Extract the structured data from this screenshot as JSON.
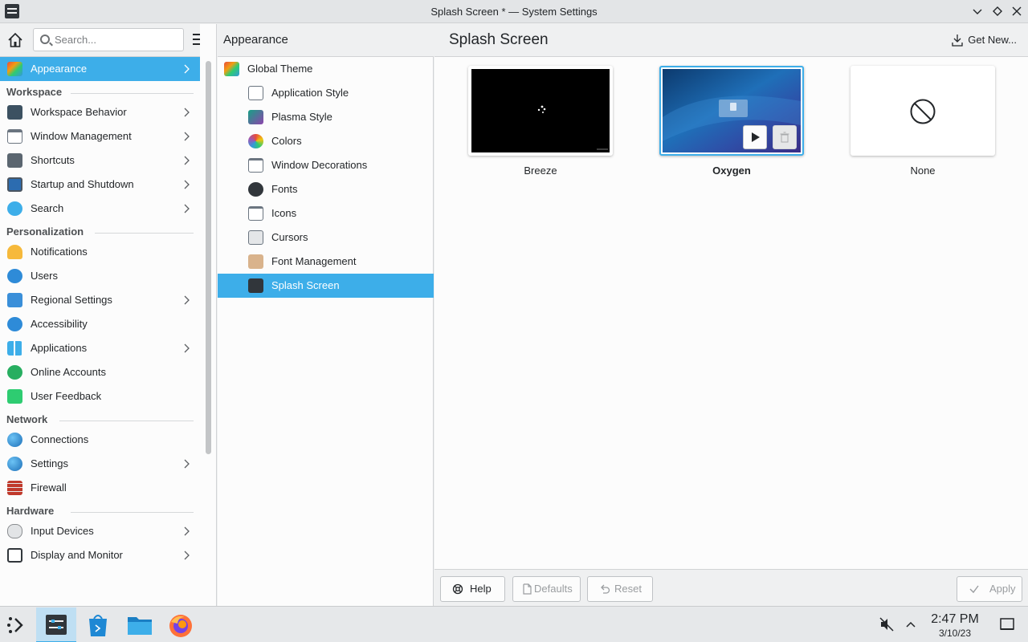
{
  "window": {
    "title": "Splash Screen * — System Settings",
    "controls": {
      "minimize": "⌄",
      "maximize": "◇",
      "close": "✕"
    }
  },
  "sidebar": {
    "search_placeholder": "Search...",
    "items": [
      {
        "label": "Appearance",
        "icon": "appearance-icon",
        "chevron": true,
        "active": true
      },
      {
        "category": "Workspace"
      },
      {
        "label": "Workspace Behavior",
        "icon": "workspace-behavior-icon",
        "chevron": true
      },
      {
        "label": "Window Management",
        "icon": "window-management-icon",
        "chevron": true
      },
      {
        "label": "Shortcuts",
        "icon": "keyboard-icon",
        "chevron": true
      },
      {
        "label": "Startup and Shutdown",
        "icon": "startup-icon",
        "chevron": true
      },
      {
        "label": "Search",
        "icon": "search-icon",
        "chevron": true
      },
      {
        "category": "Personalization"
      },
      {
        "label": "Notifications",
        "icon": "bell-icon"
      },
      {
        "label": "Users",
        "icon": "users-icon"
      },
      {
        "label": "Regional Settings",
        "icon": "regional-icon",
        "chevron": true
      },
      {
        "label": "Accessibility",
        "icon": "accessibility-icon"
      },
      {
        "label": "Applications",
        "icon": "applications-icon",
        "chevron": true
      },
      {
        "label": "Online Accounts",
        "icon": "online-accounts-icon"
      },
      {
        "label": "User Feedback",
        "icon": "feedback-icon"
      },
      {
        "category": "Network"
      },
      {
        "label": "Connections",
        "icon": "globe-icon"
      },
      {
        "label": "Settings",
        "icon": "network-settings-icon",
        "chevron": true
      },
      {
        "label": "Firewall",
        "icon": "firewall-icon"
      },
      {
        "category": "Hardware"
      },
      {
        "label": "Input Devices",
        "icon": "mouse-icon",
        "chevron": true
      },
      {
        "label": "Display and Monitor",
        "icon": "monitor-icon",
        "chevron": true
      }
    ]
  },
  "middle": {
    "heading": "Appearance",
    "items": [
      {
        "label": "Global Theme",
        "icon": "global-theme-icon",
        "top": true
      },
      {
        "label": "Application Style",
        "icon": "application-style-icon"
      },
      {
        "label": "Plasma Style",
        "icon": "plasma-style-icon"
      },
      {
        "label": "Colors",
        "icon": "colors-icon"
      },
      {
        "label": "Window Decorations",
        "icon": "window-decorations-icon"
      },
      {
        "label": "Fonts",
        "icon": "fonts-icon"
      },
      {
        "label": "Icons",
        "icon": "icons-icon"
      },
      {
        "label": "Cursors",
        "icon": "cursors-icon"
      },
      {
        "label": "Font Management",
        "icon": "font-management-icon"
      },
      {
        "label": "Splash Screen",
        "icon": "splash-screen-icon",
        "active": true
      }
    ]
  },
  "main": {
    "heading": "Splash Screen",
    "get_new_label": "Get New...",
    "themes": [
      {
        "label": "Breeze",
        "selected": false
      },
      {
        "label": "Oxygen",
        "selected": true
      },
      {
        "label": "None",
        "selected": false
      }
    ],
    "footer": {
      "help_label": "Help",
      "defaults_label": "Defaults",
      "reset_label": "Reset",
      "apply_label": "Apply"
    }
  },
  "taskbar": {
    "time": "2:47 PM",
    "date": "3/10/23"
  },
  "colors": {
    "accent": "#3daee9",
    "panel_bg": "#eff0f1",
    "view_bg": "#fcfcfc"
  }
}
